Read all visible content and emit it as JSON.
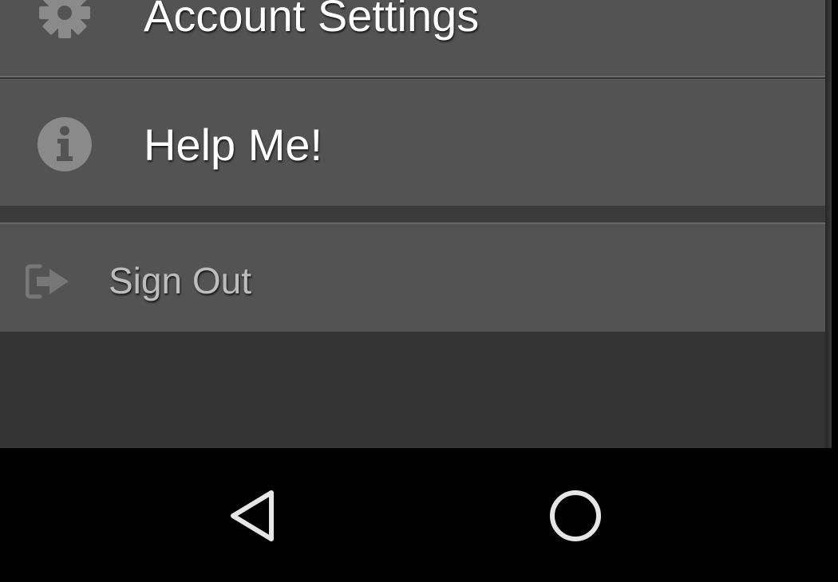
{
  "menu": {
    "items": [
      {
        "label": "Account Settings",
        "icon": "gear-icon"
      },
      {
        "label": "Help Me!",
        "icon": "info-icon"
      }
    ],
    "sign_out": {
      "label": "Sign Out",
      "icon": "sign-out-icon"
    }
  },
  "navbar": {
    "buttons": [
      {
        "name": "back",
        "icon": "back-triangle-icon"
      },
      {
        "name": "home",
        "icon": "home-circle-icon"
      }
    ]
  },
  "colors": {
    "drawer_background": "#343434",
    "item_background": "#535353",
    "label_text": "#ffffff",
    "sign_out_text": "#bdbdbd",
    "navbar_background": "#000000"
  }
}
